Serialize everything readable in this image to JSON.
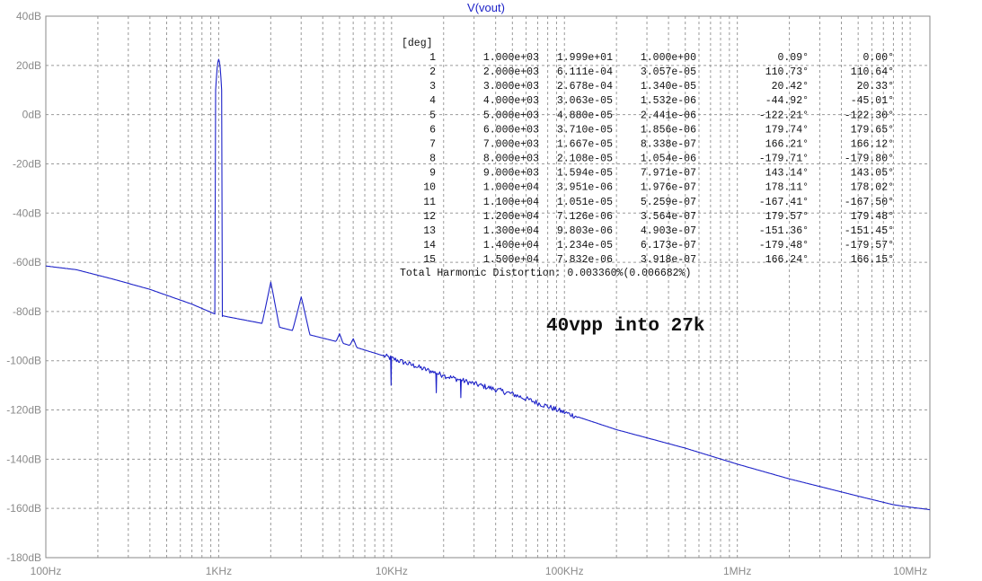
{
  "chart_data": {
    "type": "line",
    "title": "V(vout)",
    "xscale": "log",
    "xlim": [
      100,
      13000000
    ],
    "ylim": [
      -180,
      40
    ],
    "x_ticks": [
      {
        "value": 100,
        "label": "100Hz"
      },
      {
        "value": 1000,
        "label": "1KHz"
      },
      {
        "value": 10000,
        "label": "10KHz"
      },
      {
        "value": 100000,
        "label": "100KHz"
      },
      {
        "value": 1000000,
        "label": "1MHz"
      },
      {
        "value": 10000000,
        "label": "10MHz"
      }
    ],
    "y_ticks": [
      {
        "value": 40,
        "label": "40dB"
      },
      {
        "value": 20,
        "label": "20dB"
      },
      {
        "value": 0,
        "label": "0dB"
      },
      {
        "value": -20,
        "label": "-20dB"
      },
      {
        "value": -40,
        "label": "-40dB"
      },
      {
        "value": -60,
        "label": "-60dB"
      },
      {
        "value": -80,
        "label": "-80dB"
      },
      {
        "value": -100,
        "label": "-100dB"
      },
      {
        "value": -120,
        "label": "-120dB"
      },
      {
        "value": -140,
        "label": "-140dB"
      },
      {
        "value": -160,
        "label": "-160dB"
      },
      {
        "value": -180,
        "label": "-180dB"
      }
    ],
    "grid": true,
    "series_color": "#1d22c8",
    "noise_floor": {
      "x": [
        100,
        150,
        250,
        400,
        700,
        950,
        1100,
        2000,
        5000,
        10000,
        20000,
        50000,
        100000,
        200000,
        500000,
        1000000,
        2000000,
        5000000,
        8000000,
        10000000,
        13000000
      ],
      "y": [
        -61.5,
        -63,
        -67,
        -71,
        -77,
        -81,
        -82,
        -85.5,
        -92.5,
        -99,
        -106,
        -113.5,
        -121,
        -128,
        -135.5,
        -142,
        -148,
        -155,
        -158.5,
        -159.5,
        -160.5
      ]
    },
    "fundamental": {
      "x": [
        950,
        960,
        970,
        980,
        990,
        1000,
        1010,
        1020,
        1030,
        1040,
        1050
      ],
      "y": [
        -81,
        10,
        15,
        19,
        21.5,
        22.5,
        21.5,
        19,
        15,
        10,
        -82
      ]
    },
    "spurs": [
      {
        "x": 2000,
        "y": -68,
        "w": 0.05
      },
      {
        "x": 3000,
        "y": -74,
        "w": 0.05
      },
      {
        "x": 5000,
        "y": -89,
        "w": 0.02
      },
      {
        "x": 6000,
        "y": -91,
        "w": 0.02
      },
      {
        "x": 8000,
        "y": -97,
        "w": 0.012
      },
      {
        "x": 10000,
        "y": -102,
        "w": 0.008
      },
      {
        "x": 12000,
        "y": -102,
        "w": 0.008
      },
      {
        "x": 13500,
        "y": -103,
        "w": 0.008
      },
      {
        "x": 15000,
        "y": -104,
        "w": 0.008
      },
      {
        "x": 17000,
        "y": -105,
        "w": 0.008
      },
      {
        "x": 20000,
        "y": -106,
        "w": 0.008
      },
      {
        "x": 23000,
        "y": -107,
        "w": 0.008
      },
      {
        "x": 27000,
        "y": -108,
        "w": 0.008
      }
    ],
    "dips": [
      {
        "x": 9900,
        "y": -110
      },
      {
        "x": 18000,
        "y": -113
      },
      {
        "x": 25000,
        "y": -115
      },
      {
        "x": 35000,
        "y": -116
      }
    ],
    "fourier_table": {
      "header": "[deg]",
      "rows": [
        [
          "1",
          "1.000e+03",
          "1.999e+01",
          "1.000e+00",
          "0.09°",
          "0.00°"
        ],
        [
          "2",
          "2.000e+03",
          "6.111e-04",
          "3.057e-05",
          "110.73°",
          "110.64°"
        ],
        [
          "3",
          "3.000e+03",
          "2.678e-04",
          "1.340e-05",
          "20.42°",
          "20.33°"
        ],
        [
          "4",
          "4.000e+03",
          "3.063e-05",
          "1.532e-06",
          "-44.92°",
          "-45.01°"
        ],
        [
          "5",
          "5.000e+03",
          "4.880e-05",
          "2.441e-06",
          "-122.21°",
          "-122.30°"
        ],
        [
          "6",
          "6.000e+03",
          "3.710e-05",
          "1.856e-06",
          "179.74°",
          "179.65°"
        ],
        [
          "7",
          "7.000e+03",
          "1.667e-05",
          "8.338e-07",
          "166.21°",
          "166.12°"
        ],
        [
          "8",
          "8.000e+03",
          "2.108e-05",
          "1.054e-06",
          "-179.71°",
          "-179.80°"
        ],
        [
          "9",
          "9.000e+03",
          "1.594e-05",
          "7.971e-07",
          "143.14°",
          "143.05°"
        ],
        [
          "10",
          "1.000e+04",
          "3.951e-06",
          "1.976e-07",
          "178.11°",
          "178.02°"
        ],
        [
          "11",
          "1.100e+04",
          "1.051e-05",
          "5.259e-07",
          "-167.41°",
          "-167.50°"
        ],
        [
          "12",
          "1.200e+04",
          "7.126e-06",
          "3.564e-07",
          "179.57°",
          "179.48°"
        ],
        [
          "13",
          "1.300e+04",
          "9.803e-06",
          "4.903e-07",
          "-151.36°",
          "-151.45°"
        ],
        [
          "14",
          "1.400e+04",
          "1.234e-05",
          "6.173e-07",
          "-179.48°",
          "-179.57°"
        ],
        [
          "15",
          "1.500e+04",
          "7.832e-06",
          "3.918e-07",
          "166.24°",
          "166.15°"
        ]
      ],
      "thd": "Total Harmonic Distortion: 0.003360%(0.006682%)"
    },
    "annotation": "40vpp into 27k"
  }
}
